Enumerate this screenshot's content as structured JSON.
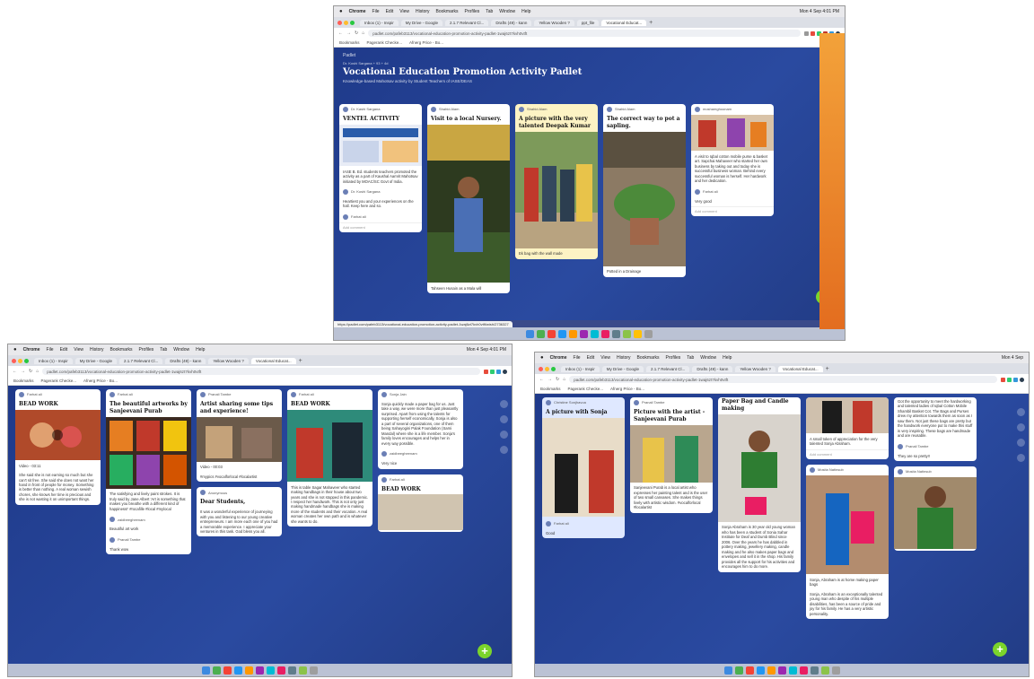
{
  "mac_menu": {
    "apple": "",
    "app": "Chrome",
    "items": [
      "File",
      "Edit",
      "View",
      "History",
      "Bookmarks",
      "Profiles",
      "Tab",
      "Window",
      "Help"
    ],
    "clock_top": "Mon 4 Sep 4:01 PM",
    "clock_left": "Mon 4 Sep 4:01 PM",
    "clock_right": "Mon 4 Sep"
  },
  "browser": {
    "tabs": [
      "Inbox (1) - Inspir",
      "My Drive - Google",
      "2.1.7 Relevant Cl...",
      "Drafts (49) - kann",
      "Yellow Wooden ?",
      "ppt_file",
      "Vocational Educat..."
    ],
    "tab_plus": "+",
    "url": "padlet.com/pafeb3113/vocational-education-promotion-activity-padlet-1waj6zt7kvh0vtft",
    "bookmarks": [
      "Bookmarks",
      "Pagerank Checke...",
      "Afnerg Price - Bo..."
    ],
    "status_url": "https://padlet.com/pafeb3113/vocational-education-promotion-activity-padlet-1waj6zt7kvh0vtft/wish/2736327"
  },
  "padlet": {
    "brand": "Padlet",
    "author": "Dr. Koshi Sargana + 93 + 4d",
    "title": "Vocational Education Promotion Activity Padlet",
    "subtitle": "Knowledge-based Mahotsav activity by Student Teachers of IASE/DEAS",
    "fab": "+"
  },
  "cards": {
    "ventel": {
      "author": "Dr. Kashi Sargana",
      "title": "VENTEL ACTIVITY",
      "body": "IASE B. Ed. students teachers promoted the activity as a part of Kaushal Aamrit Mahotsav initiated by MOAC/SC Govt of India.",
      "comment_author": "Dr. Koshi Sargana",
      "comment": "Heartiest you and your experiences on the hall. Keep here and so.",
      "comment2_author": "Farhat ali",
      "add_comment": "Add comment"
    },
    "nursery": {
      "author": "Shahid Alam",
      "title": "Visit to a local Nursery.",
      "caption": "Tahseen Husain as a Mala will"
    },
    "deepak": {
      "author": "Shahid Alam",
      "title": "A picture with the very talented Deepak Kumar",
      "body": "Ek bag with the wall made"
    },
    "sapling": {
      "author": "Shahid Alam",
      "title": "The correct way to pot a sapling.",
      "body": "Potted in a Drainage"
    },
    "iqbal": {
      "author": "moshamghoonam",
      "body": "A visit to Iqbal cotton mobile purse & basket art. Sapchai Mahaveer who started her own business by taking out and today she is successful business woman. Behind every successful woman is herself. Her hardwork and her dedication.",
      "comment_author": "Farhat ali",
      "comment": "Very good",
      "add_comment": "Add comment"
    },
    "artworks": {
      "author": "Farhat ali",
      "title": "The beautiful artworks by Sanjeevani Purab",
      "body": "The satisfying and lively paint strokes. It is truly said by Jane Albert 'Art is something that makes you breathe with a different kind of happiness!' #rocafille #local #mylocal",
      "comment_author": "zaidbeegheenam",
      "comment": "Beautiful art work",
      "comment2_author": "Pranali Tambe",
      "comment2": "Thank wow"
    },
    "bead1": {
      "author": "Farhat ali",
      "title": "BEAD WORK",
      "video": "Video - 03:11",
      "body": "She said she is not earning so much but she can't sit free. She said she does not want her hand in front of people for money. Something is better than nothing. A real woman sewish chores, she knows her time is precious and she is not wasting it on unimportant things."
    },
    "artist": {
      "author": "Pranali Tambe",
      "title": "Artist sharing some tips and experience!",
      "video": "Video - 00:03",
      "body": "#mypics #vocalforlocal #localartist"
    },
    "students": {
      "author": "Anonymous",
      "title": "Dear Students,",
      "body": "It was a wonderful experience of journeying with you and listening to our young creative entrepreneurs. I am more each one of you had a memorable experience. I appreciate your ventures in this task. God bless you all."
    },
    "bead2": {
      "author": "Farhat ali",
      "title": "BEAD WORK",
      "body": "This is table Sagar Mahaveer who started making handbags in their house about two years and she is not stopped in this pandemic. I respect her handiwork. This is not only just making handmade handbags she is making more of the students and their vocation. A real woman creates her own path and is whatever she wants to do."
    },
    "sonja": {
      "author": "Sonja Jain",
      "body": "Sonja quickly made a paper bag for us. Just take a way, we were more than just pleasantly surprised. Apart from using the talents for supporting herself economically, Sonja is also a part of several organizations, one of them being Sahayogini Palak Foundation (Sarni Mandal) where she is a life member. Sonja's family loves encourages and helps her in every way possible.",
      "comment_author": "zaidbeegheenam",
      "comment": "Very nice"
    },
    "bead3": {
      "author": "Farhat ali",
      "title": "BEAD WORK"
    },
    "sonja_pic": {
      "author": "Christine Sonjhavoa",
      "title": "A picture with Sonja",
      "comment_author": "Farhat ali",
      "comment": "Good"
    },
    "purab": {
      "author": "Pranali Tambe",
      "title": "Picture with the artist - Sanjeevani Purab",
      "body": "Sanjeevani Purab is a local artist who expresses her painting talent and is the user of two small canvases. She makes things lively with artistic wisdom. #vocalforlocal #localartist"
    },
    "paper_bag": {
      "title": "Paper Bag and Candle making",
      "body": "Sonja Abraham is 30 year old young woman who has been a student of Sonia Sahar Institute for Deaf and Dumb Blind since 2006. Over the years he has dabbled in pottery making, jewellery making, candle making and he also makes paper bags and envelopes and sell it in the shop. His family provides all the support for his activities and encourages him to do more."
    },
    "iqbal2": {
      "body": "A small token of appreciation for the very talented Sonja Abraham.",
      "comment": "Add comment"
    },
    "abul": {
      "author": "Mosita Natinsub",
      "caption": "Sonja, Abraham is at home making paper bags",
      "body": "Sonja, Abraham is an exceptionally talented young man who despite of his multiple disabilities, has been a source of pride and joy for his family. He has a very artistic personality."
    },
    "iqbal3": {
      "body": "Got the opportunity to meet the hardworking and talented ladies of Iqbal Cotton Mobile Shambil Basket Cot. The Bags and Purses drew my attention towards them as soon as I saw them. Not just these bags are pretty but the handwork everyone put to make this stuff is very inspiring. These bags are handmade and are reusable.",
      "comment_author": "Pranali Tambe",
      "comment": "They are so pretty!!"
    },
    "boy": {
      "author": "Mosita Natinsub"
    }
  },
  "colors": {
    "padlet_bg": "#1f3a8a",
    "fab": "#7bd42b",
    "card_yellow": "#fdf3c4",
    "card_blue": "#dfe8ff"
  }
}
